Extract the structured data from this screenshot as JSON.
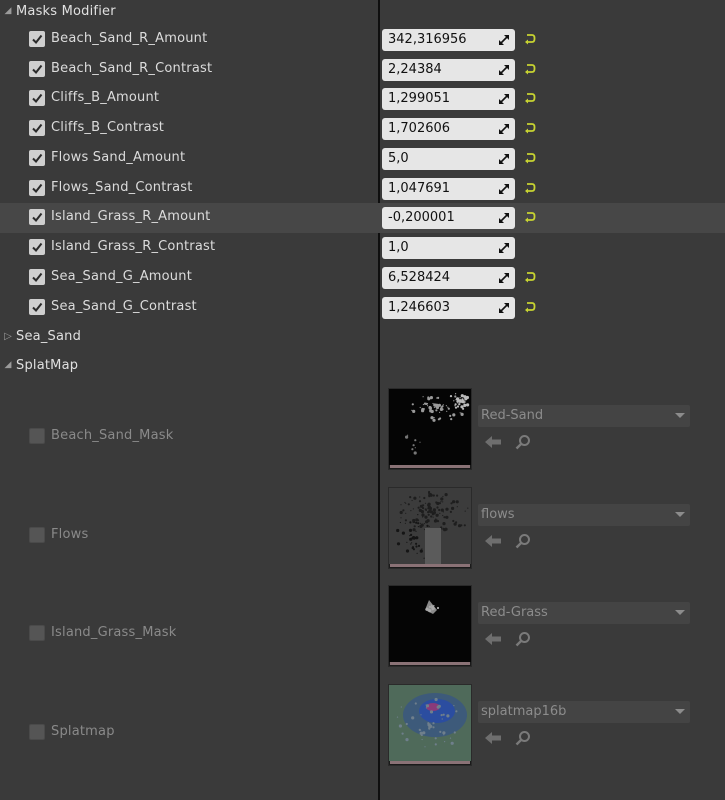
{
  "sections": {
    "masks_modifier": "Masks Modifier",
    "sea_sand": "Sea_Sand",
    "splatmap": "SplatMap"
  },
  "params": [
    {
      "label": "Beach_Sand_R_Amount",
      "value": "342,316956",
      "reset": true,
      "checked": true
    },
    {
      "label": "Beach_Sand_R_Contrast",
      "value": "2,24384",
      "reset": true,
      "checked": true
    },
    {
      "label": "Cliffs_B_Amount",
      "value": "1,299051",
      "reset": true,
      "checked": true
    },
    {
      "label": "Cliffs_B_Contrast",
      "value": "1,702606",
      "reset": true,
      "checked": true
    },
    {
      "label": "Flows Sand_Amount",
      "value": "5,0",
      "reset": true,
      "checked": true
    },
    {
      "label": "Flows_Sand_Contrast",
      "value": "1,047691",
      "reset": true,
      "checked": true
    },
    {
      "label": "Island_Grass_R_Amount",
      "value": "-0,200001",
      "reset": true,
      "checked": true,
      "highlighted": true
    },
    {
      "label": "Island_Grass_R_Contrast",
      "value": "1,0",
      "reset": false,
      "checked": true
    },
    {
      "label": "Sea_Sand_G_Amount",
      "value": "6,528424",
      "reset": true,
      "checked": true
    },
    {
      "label": "Sea_Sand_G_Contrast",
      "value": "1,246603",
      "reset": true,
      "checked": true
    }
  ],
  "textures": [
    {
      "label": "Beach_Sand_Mask",
      "asset": "Red-Sand",
      "thumb": "red-sand"
    },
    {
      "label": "Flows",
      "asset": "flows",
      "thumb": "flows"
    },
    {
      "label": "Island_Grass_Mask",
      "asset": "Red-Grass",
      "thumb": "red-grass"
    },
    {
      "label": "Splatmap",
      "asset": "splatmap16b",
      "thumb": "splatmap"
    }
  ],
  "colors": {
    "background": "#3a3a3a",
    "highlight_row": "#474747",
    "reset_arrow": "#c8d431",
    "divider": "#0f0f0f"
  },
  "icons": {
    "expand": "triangle-down-icon",
    "collapsed": "triangle-right-icon",
    "spin": "drag-arrows-icon",
    "reset": "reset-to-default-icon",
    "use_selected": "arrow-left-icon",
    "browse": "magnifier-icon"
  }
}
